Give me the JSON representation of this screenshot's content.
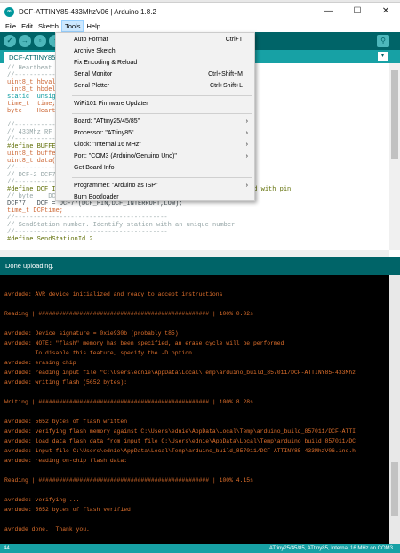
{
  "window": {
    "title": "DCF-ATTINY85-433MhzV06 | Arduino 1.8.2",
    "icon_label": "∞",
    "controls": [
      "—",
      "☐",
      "✕"
    ]
  },
  "menu": [
    "File",
    "Edit",
    "Sketch",
    "Tools",
    "Help"
  ],
  "toolbar": {
    "buttons": [
      {
        "name": "verify",
        "glyph": "✓"
      },
      {
        "name": "upload",
        "glyph": "→"
      },
      {
        "name": "new",
        "glyph": "▫"
      },
      {
        "name": "open",
        "glyph": "↑"
      },
      {
        "name": "save",
        "glyph": "↓"
      }
    ],
    "search_glyph": "⚲"
  },
  "tab": {
    "label": "DCF-ATTINY85",
    "menu_glyph": "▾"
  },
  "editor_lines": [
    {
      "text": "// Heartbeat",
      "cls": "c-comment"
    },
    {
      "text": "//------------",
      "cls": "c-comment"
    },
    {
      "text": "uint8_t hbval",
      "cls": "c-type"
    },
    {
      "text": " int8_t hbdel",
      "cls": "c-type"
    },
    {
      "text": "static  unsig",
      "cls": "c-kw"
    },
    {
      "text": "time_t  time;",
      "cls": "c-type"
    },
    {
      "text": "byte    Heart",
      "cls": "c-type"
    },
    {
      "text": "",
      "cls": ""
    },
    {
      "text": "//------------",
      "cls": "c-comment"
    },
    {
      "text": "// 433Mhz RF",
      "cls": "c-comment"
    },
    {
      "text": "//------------",
      "cls": "c-comment"
    },
    {
      "text": "#define BUFFE",
      "cls": "c-pre"
    },
    {
      "text": "uint8_t buffe",
      "cls": "c-type"
    },
    {
      "text": "uint8_t data(",
      "cls": "c-type"
    },
    {
      "text": "//------------",
      "cls": "c-comment"
    },
    {
      "text": "// DCF-2 DCF7",
      "cls": "c-comment"
    },
    {
      "text": "//------------",
      "cls": "c-comment"
    },
    {
      "text": "#define DCF_INTERRUPT 0              // Interrupt number associated with pin",
      "cls": "c-pre"
    },
    {
      "text": "// byte    DCF_signal = 0;           // is a proper time received?",
      "cls": "c-comment"
    },
    {
      "text": "DCF77   DCF = DCF77(DCF_PIN,DCF_INTERRUPT,LOW);",
      "cls": ""
    },
    {
      "text": "time_t DCFtime;",
      "cls": "c-type"
    },
    {
      "text": "//-----------------------------------------",
      "cls": "c-comment"
    },
    {
      "text": "// SendStation number. Identify station with an unique number",
      "cls": "c-comment"
    },
    {
      "text": "//-----------------------------------------",
      "cls": "c-comment"
    },
    {
      "text": "#define SendStationId 2",
      "cls": "c-pre"
    }
  ],
  "tools_menu": [
    {
      "label": "Auto Format",
      "shortcut": "Ctrl+T"
    },
    {
      "label": "Archive Sketch"
    },
    {
      "label": "Fix Encoding & Reload"
    },
    {
      "label": "Serial Monitor",
      "shortcut": "Ctrl+Shift+M"
    },
    {
      "label": "Serial Plotter",
      "shortcut": "Ctrl+Shift+L"
    },
    {
      "sep": true
    },
    {
      "label": "WiFi101 Firmware Updater"
    },
    {
      "sep": true
    },
    {
      "label": "Board: \"ATtiny25/45/85\"",
      "submenu": true
    },
    {
      "label": "Processor: \"ATtiny85\"",
      "submenu": true
    },
    {
      "label": "Clock: \"Internal 16 MHz\"",
      "submenu": true
    },
    {
      "label": "Port: \"COM3 (Arduino/Genuino Uno)\"",
      "submenu": true
    },
    {
      "label": "Get Board Info"
    },
    {
      "sep": true
    },
    {
      "label": "Programmer: \"Arduino as ISP\"",
      "submenu": true
    },
    {
      "label": "Burn Bootloader"
    }
  ],
  "submenu_arrow": "›",
  "status_message": "Done uploading.",
  "console_lines": [
    "avrdude: AVR device initialized and ready to accept instructions",
    "",
    "Reading | ################################################## | 100% 0.02s",
    "",
    "avrdude: Device signature = 0x1e930b (probably t85)",
    "avrdude: NOTE: \"flash\" memory has been specified, an erase cycle will be performed",
    "         To disable this feature, specify the -D option.",
    "avrdude: erasing chip",
    "avrdude: reading input file \"C:\\Users\\ednie\\AppData\\Local\\Temp\\arduino_build_857011/DCF-ATTINY85-433Mhz",
    "avrdude: writing flash (5652 bytes):",
    "",
    "Writing | ################################################## | 100% 8.28s",
    "",
    "avrdude: 5652 bytes of flash written",
    "avrdude: verifying flash memory against C:\\Users\\ednie\\AppData\\Local\\Temp\\arduino_build_857011/DCF-ATTI",
    "avrdude: load data flash data from input file C:\\Users\\ednie\\AppData\\Local\\Temp\\arduino_build_857011/DC",
    "avrdude: input file C:\\Users\\ednie\\AppData\\Local\\Temp\\arduino_build_857011/DCF-ATTINY85-433MhzV06.ino.h",
    "avrdude: reading on-chip flash data:",
    "",
    "Reading | ################################################## | 100% 4.15s",
    "",
    "avrdude: verifying ...",
    "avrdude: 5652 bytes of flash verified",
    "",
    "avrdude done.  Thank you."
  ],
  "footer": {
    "line_number": "44",
    "board_info": "ATtiny25/45/85, ATtiny85, Internal 16 MHz on COM3"
  },
  "colors": {
    "toolbar": "#006468",
    "tabbar": "#17a1a5",
    "console_bg": "#000000",
    "console_text": "#e0702c",
    "menu_bg": "#f2f2f2"
  }
}
